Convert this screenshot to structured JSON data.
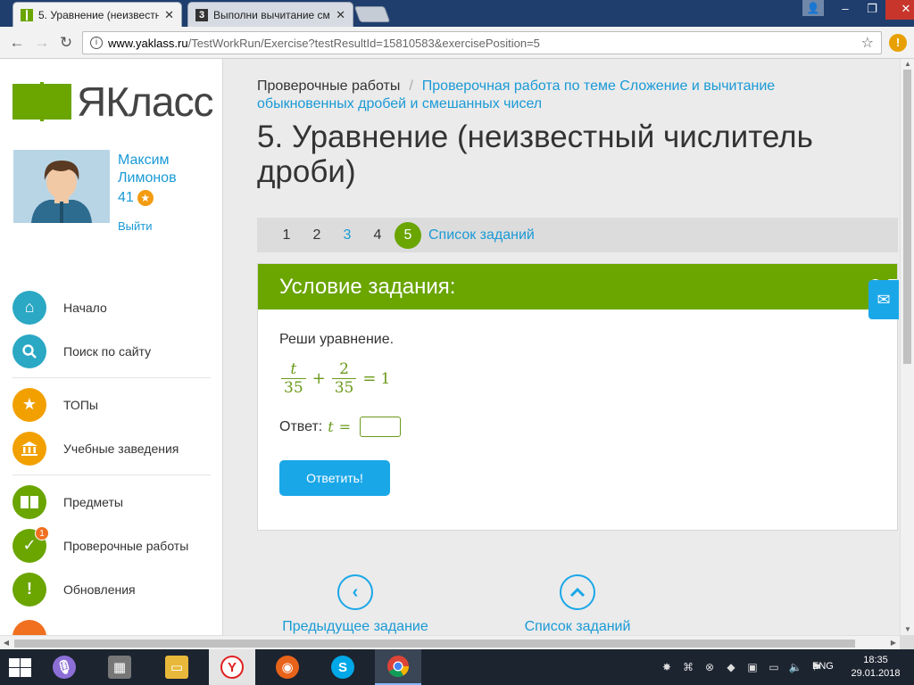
{
  "browser": {
    "tabs": [
      {
        "title": "5. Уравнение (неизвестн",
        "close": "✕",
        "active": true
      },
      {
        "title": "Выполни вычитание см",
        "close": "✕",
        "active": false
      }
    ],
    "url_host": "www.yaklass.ru",
    "url_path": "/TestWorkRun/Exercise?testResultId=15810583&exercisePosition=5",
    "window_controls": {
      "minimize": "–",
      "maximize": "❐",
      "close": "✕"
    },
    "extension_label": "!"
  },
  "brand": {
    "name": "ЯКласс",
    "accent": "#6aa500",
    "link": "#1a9ad6"
  },
  "profile": {
    "name": "Максим Лимонов",
    "points": "41",
    "logout": "Выйти"
  },
  "nav": {
    "items": [
      {
        "label": "Начало",
        "icon": "home-icon",
        "color": "#2aa8c4"
      },
      {
        "label": "Поиск по сайту",
        "icon": "search-icon",
        "color": "#2aa8c4"
      },
      {
        "label": "ТОПы",
        "icon": "star-icon",
        "color": "#f2a000"
      },
      {
        "label": "Учебные заведения",
        "icon": "building-icon",
        "color": "#f2a000"
      },
      {
        "label": "Предметы",
        "icon": "book-icon",
        "color": "#6aa500"
      },
      {
        "label": "Проверочные работы",
        "icon": "check-icon",
        "color": "#6aa500",
        "badge": "1"
      },
      {
        "label": "Обновления",
        "icon": "exclamation-icon",
        "color": "#6aa500"
      }
    ]
  },
  "breadcrumb": {
    "root": "Проверочные работы",
    "separator": "/",
    "current": "Проверочная работа по теме Сложение и вычитание обыкновенных дробей и смешанных чисел"
  },
  "page_title": "5. Уравнение (неизвестный числитель дроби)",
  "pager": {
    "pages": [
      "1",
      "2",
      "3",
      "4",
      "5"
    ],
    "current": "5",
    "list_label": "Список заданий"
  },
  "task": {
    "header": "Условие задания:",
    "score": "3 Б.",
    "question": "Реши уравнение.",
    "equation": {
      "frac1_num": "t",
      "frac1_den": "35",
      "plus": "+",
      "frac2_num": "2",
      "frac2_den": "35",
      "equals": "=",
      "rhs": "1"
    },
    "answer_label": "Ответ:",
    "answer_var": "t",
    "answer_eq": "=",
    "answer_value": "",
    "submit_label": "Ответить!"
  },
  "bottom_nav": {
    "prev_label": "Предыдущее задание",
    "list_label": "Список заданий"
  },
  "taskbar": {
    "language": "ENG",
    "time": "18:35",
    "date": "29.01.2018"
  }
}
